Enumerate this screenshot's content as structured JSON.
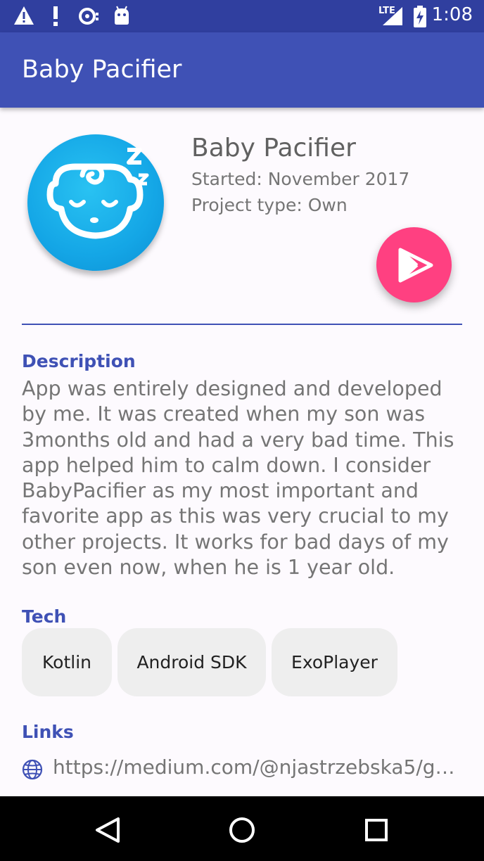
{
  "status_bar": {
    "time": "1:08",
    "network": "LTE",
    "icons": [
      "warning-icon",
      "alert-icon",
      "vpn-icon",
      "android-debug-icon",
      "signal-icon",
      "battery-charging-icon"
    ]
  },
  "app_bar": {
    "title": "Baby Pacifier"
  },
  "project": {
    "title": "Baby Pacifier",
    "started": "Started: November 2017",
    "type": "Project type: Own",
    "fab_icon": "google-play-icon"
  },
  "description": {
    "label": "Description",
    "text": "App was entirely designed and developed by me. It was created when my son was 3months old and had a very bad time. This app helped him to calm down. I consider BabyPacifier as my most important and favorite app as this was very crucial to my other projects. It works for bad days of my son even now, when he is 1 year old."
  },
  "tech": {
    "label": "Tech",
    "chips": [
      "Kotlin",
      "Android SDK",
      "ExoPlayer"
    ]
  },
  "links": {
    "label": "Links",
    "items": [
      {
        "icon": "globe-icon",
        "url": "https://medium.com/@njastrzebska5/go…"
      }
    ]
  },
  "nav_bar": {
    "buttons": [
      "back-icon",
      "home-icon",
      "recents-icon"
    ]
  },
  "colors": {
    "primary": "#3f51b5",
    "primary_dark": "#303f9f",
    "accent": "#ff4081",
    "logo_blue": "#14a6e6"
  }
}
